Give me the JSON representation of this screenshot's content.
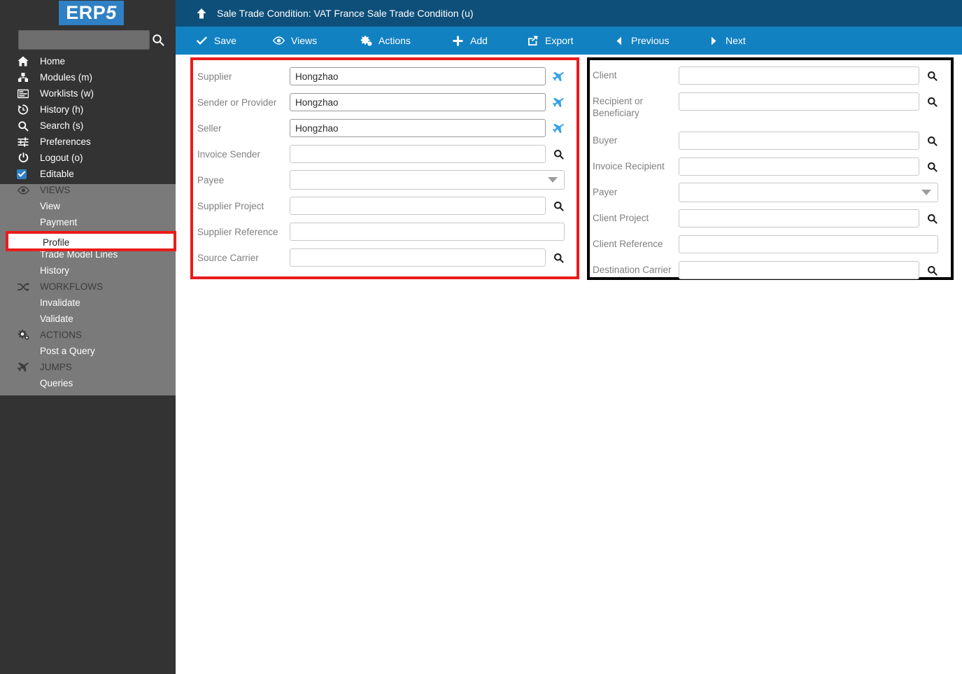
{
  "sidebar": {
    "logo": "ERP5",
    "logo_prefix": "ERP",
    "logo_suffix": "5",
    "search": {
      "value": "",
      "placeholder": "",
      "icon": "search-icon"
    },
    "items": [
      {
        "label": "Home",
        "icon": "home-icon",
        "type": "link"
      },
      {
        "label": "Modules (m)",
        "icon": "modules-icon",
        "type": "link"
      },
      {
        "label": "Worklists (w)",
        "icon": "worklists-icon",
        "type": "link"
      },
      {
        "label": "History (h)",
        "icon": "history-icon",
        "type": "link"
      },
      {
        "label": "Search (s)",
        "icon": "search-icon",
        "type": "link"
      },
      {
        "label": "Preferences",
        "icon": "preferences-icon",
        "type": "link"
      },
      {
        "label": "Logout (o)",
        "icon": "power-icon",
        "type": "link"
      },
      {
        "label": "Editable",
        "icon": "checkbox-checked-icon",
        "type": "checkbox"
      }
    ],
    "groups": [
      {
        "label": "VIEWS",
        "icon": "eye-icon",
        "items": [
          {
            "label": "View"
          },
          {
            "label": "Payment"
          },
          {
            "label": "Profile",
            "selected": true
          },
          {
            "label": "Trade Model Lines"
          },
          {
            "label": "History"
          }
        ]
      },
      {
        "label": "WORKFLOWS",
        "icon": "shuffle-icon",
        "items": [
          {
            "label": "Invalidate"
          },
          {
            "label": "Validate"
          }
        ]
      },
      {
        "label": "ACTIONS",
        "icon": "gears-icon",
        "items": [
          {
            "label": "Post a Query"
          }
        ]
      },
      {
        "label": "JUMPS",
        "icon": "plane-icon",
        "items": [
          {
            "label": "Queries"
          }
        ]
      }
    ]
  },
  "header": {
    "up_icon": "arrow-up-icon",
    "title": "Sale Trade Condition: VAT France Sale Trade Condition (u)"
  },
  "toolbar": {
    "buttons": [
      {
        "label": "Save",
        "icon": "check-icon"
      },
      {
        "label": "Views",
        "icon": "eye-icon"
      },
      {
        "label": "Actions",
        "icon": "gears-icon"
      },
      {
        "label": "Add",
        "icon": "plus-icon"
      },
      {
        "label": "Export",
        "icon": "export-icon"
      },
      {
        "label": "Previous",
        "icon": "caret-left-icon"
      },
      {
        "label": "Next",
        "icon": "caret-right-icon"
      }
    ]
  },
  "panels": {
    "left": {
      "border_color": "#e81c1c",
      "fields": [
        {
          "label": "Supplier",
          "value": "Hongzhao",
          "control": "text",
          "icon": "plane-icon"
        },
        {
          "label": "Sender or Provider",
          "value": "Hongzhao",
          "control": "text",
          "icon": "plane-icon"
        },
        {
          "label": "Seller",
          "value": "Hongzhao",
          "control": "text",
          "icon": "plane-icon"
        },
        {
          "label": "Invoice Sender",
          "value": "",
          "control": "text",
          "icon": "search-icon"
        },
        {
          "label": "Payee",
          "value": "",
          "control": "select",
          "icon": "chevron-down-icon"
        },
        {
          "label": "Supplier Project",
          "value": "",
          "control": "text",
          "icon": "search-icon"
        },
        {
          "label": "Supplier Reference",
          "value": "",
          "control": "text",
          "icon": "none"
        },
        {
          "label": "Source Carrier",
          "value": "",
          "control": "text",
          "icon": "search-icon"
        }
      ]
    },
    "right": {
      "border_color": "#000000",
      "fields": [
        {
          "label": "Client",
          "value": "",
          "control": "text",
          "icon": "search-icon"
        },
        {
          "label": "Recipient or Beneficiary",
          "value": "",
          "control": "text",
          "icon": "search-icon"
        },
        {
          "label": "Buyer",
          "value": "",
          "control": "text",
          "icon": "search-icon"
        },
        {
          "label": "Invoice Recipient",
          "value": "",
          "control": "text",
          "icon": "search-icon"
        },
        {
          "label": "Payer",
          "value": "",
          "control": "select",
          "icon": "chevron-down-icon"
        },
        {
          "label": "Client Project",
          "value": "",
          "control": "text",
          "icon": "search-icon"
        },
        {
          "label": "Client Reference",
          "value": "",
          "control": "text",
          "icon": "none"
        },
        {
          "label": "Destination Carrier",
          "value": "",
          "control": "text",
          "icon": "search-icon"
        }
      ]
    }
  },
  "colors": {
    "header_bg": "#0d4f79",
    "toolbar_bg": "#1281c2",
    "sidebar_dark": "#333333",
    "sidebar_gray": "#7a7a7a",
    "logo_bg": "#2f80c4",
    "accent_red": "#e81c1c",
    "jump_icon": "#36a2e8",
    "label_gray": "#808080"
  }
}
